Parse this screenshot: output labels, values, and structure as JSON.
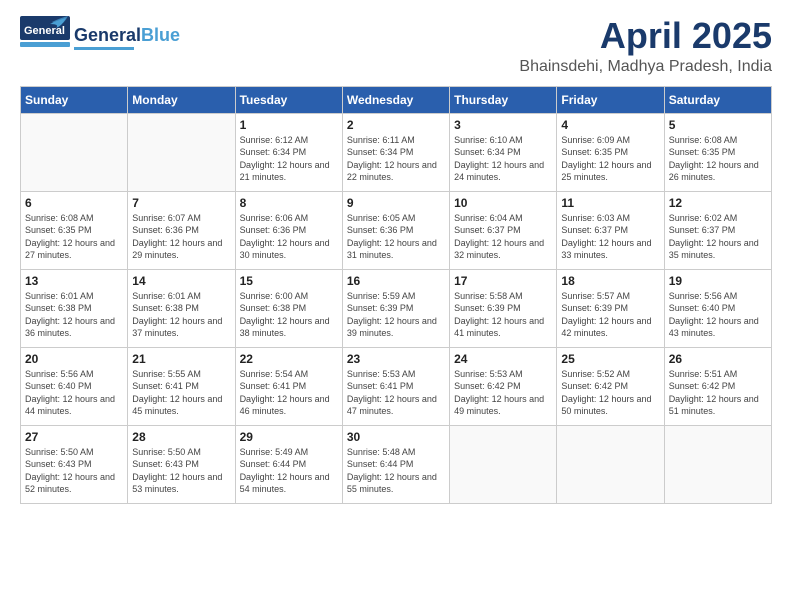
{
  "header": {
    "logo_general": "General",
    "logo_blue": "Blue",
    "month_title": "April 2025",
    "location": "Bhainsdehi, Madhya Pradesh, India"
  },
  "weekdays": [
    "Sunday",
    "Monday",
    "Tuesday",
    "Wednesday",
    "Thursday",
    "Friday",
    "Saturday"
  ],
  "weeks": [
    [
      null,
      null,
      {
        "day": 1,
        "sunrise": "6:12 AM",
        "sunset": "6:34 PM",
        "daylight": "12 hours and 21 minutes."
      },
      {
        "day": 2,
        "sunrise": "6:11 AM",
        "sunset": "6:34 PM",
        "daylight": "12 hours and 22 minutes."
      },
      {
        "day": 3,
        "sunrise": "6:10 AM",
        "sunset": "6:34 PM",
        "daylight": "12 hours and 24 minutes."
      },
      {
        "day": 4,
        "sunrise": "6:09 AM",
        "sunset": "6:35 PM",
        "daylight": "12 hours and 25 minutes."
      },
      {
        "day": 5,
        "sunrise": "6:08 AM",
        "sunset": "6:35 PM",
        "daylight": "12 hours and 26 minutes."
      }
    ],
    [
      {
        "day": 6,
        "sunrise": "6:08 AM",
        "sunset": "6:35 PM",
        "daylight": "12 hours and 27 minutes."
      },
      {
        "day": 7,
        "sunrise": "6:07 AM",
        "sunset": "6:36 PM",
        "daylight": "12 hours and 29 minutes."
      },
      {
        "day": 8,
        "sunrise": "6:06 AM",
        "sunset": "6:36 PM",
        "daylight": "12 hours and 30 minutes."
      },
      {
        "day": 9,
        "sunrise": "6:05 AM",
        "sunset": "6:36 PM",
        "daylight": "12 hours and 31 minutes."
      },
      {
        "day": 10,
        "sunrise": "6:04 AM",
        "sunset": "6:37 PM",
        "daylight": "12 hours and 32 minutes."
      },
      {
        "day": 11,
        "sunrise": "6:03 AM",
        "sunset": "6:37 PM",
        "daylight": "12 hours and 33 minutes."
      },
      {
        "day": 12,
        "sunrise": "6:02 AM",
        "sunset": "6:37 PM",
        "daylight": "12 hours and 35 minutes."
      }
    ],
    [
      {
        "day": 13,
        "sunrise": "6:01 AM",
        "sunset": "6:38 PM",
        "daylight": "12 hours and 36 minutes."
      },
      {
        "day": 14,
        "sunrise": "6:01 AM",
        "sunset": "6:38 PM",
        "daylight": "12 hours and 37 minutes."
      },
      {
        "day": 15,
        "sunrise": "6:00 AM",
        "sunset": "6:38 PM",
        "daylight": "12 hours and 38 minutes."
      },
      {
        "day": 16,
        "sunrise": "5:59 AM",
        "sunset": "6:39 PM",
        "daylight": "12 hours and 39 minutes."
      },
      {
        "day": 17,
        "sunrise": "5:58 AM",
        "sunset": "6:39 PM",
        "daylight": "12 hours and 41 minutes."
      },
      {
        "day": 18,
        "sunrise": "5:57 AM",
        "sunset": "6:39 PM",
        "daylight": "12 hours and 42 minutes."
      },
      {
        "day": 19,
        "sunrise": "5:56 AM",
        "sunset": "6:40 PM",
        "daylight": "12 hours and 43 minutes."
      }
    ],
    [
      {
        "day": 20,
        "sunrise": "5:56 AM",
        "sunset": "6:40 PM",
        "daylight": "12 hours and 44 minutes."
      },
      {
        "day": 21,
        "sunrise": "5:55 AM",
        "sunset": "6:41 PM",
        "daylight": "12 hours and 45 minutes."
      },
      {
        "day": 22,
        "sunrise": "5:54 AM",
        "sunset": "6:41 PM",
        "daylight": "12 hours and 46 minutes."
      },
      {
        "day": 23,
        "sunrise": "5:53 AM",
        "sunset": "6:41 PM",
        "daylight": "12 hours and 47 minutes."
      },
      {
        "day": 24,
        "sunrise": "5:53 AM",
        "sunset": "6:42 PM",
        "daylight": "12 hours and 49 minutes."
      },
      {
        "day": 25,
        "sunrise": "5:52 AM",
        "sunset": "6:42 PM",
        "daylight": "12 hours and 50 minutes."
      },
      {
        "day": 26,
        "sunrise": "5:51 AM",
        "sunset": "6:42 PM",
        "daylight": "12 hours and 51 minutes."
      }
    ],
    [
      {
        "day": 27,
        "sunrise": "5:50 AM",
        "sunset": "6:43 PM",
        "daylight": "12 hours and 52 minutes."
      },
      {
        "day": 28,
        "sunrise": "5:50 AM",
        "sunset": "6:43 PM",
        "daylight": "12 hours and 53 minutes."
      },
      {
        "day": 29,
        "sunrise": "5:49 AM",
        "sunset": "6:44 PM",
        "daylight": "12 hours and 54 minutes."
      },
      {
        "day": 30,
        "sunrise": "5:48 AM",
        "sunset": "6:44 PM",
        "daylight": "12 hours and 55 minutes."
      },
      null,
      null,
      null
    ]
  ]
}
